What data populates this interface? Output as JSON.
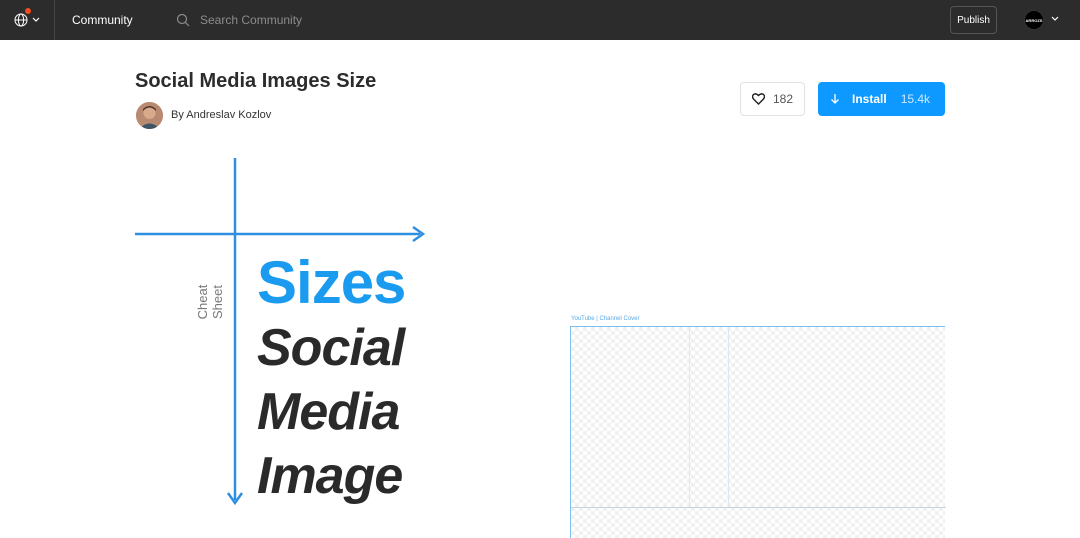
{
  "topbar": {
    "nav_label": "Community",
    "search_placeholder": "Search Community",
    "publish_label": "Publish",
    "avatar_text": "ARROZS"
  },
  "plugin": {
    "title": "Social Media Images Size",
    "author": "By Andreslav Kozlov",
    "likes": "182",
    "install_label": "Install",
    "install_count": "15.4k"
  },
  "cover": {
    "vertical_label": "Cheat Sheet",
    "line1": "Sizes",
    "line2": "Social",
    "line3": "Media",
    "line4": "Image",
    "frame_label": "YouTube | Channel Cover"
  },
  "colors": {
    "topbar_bg": "#2c2c2c",
    "accent": "#0d99ff",
    "cover_blue": "#1a9bf0"
  }
}
